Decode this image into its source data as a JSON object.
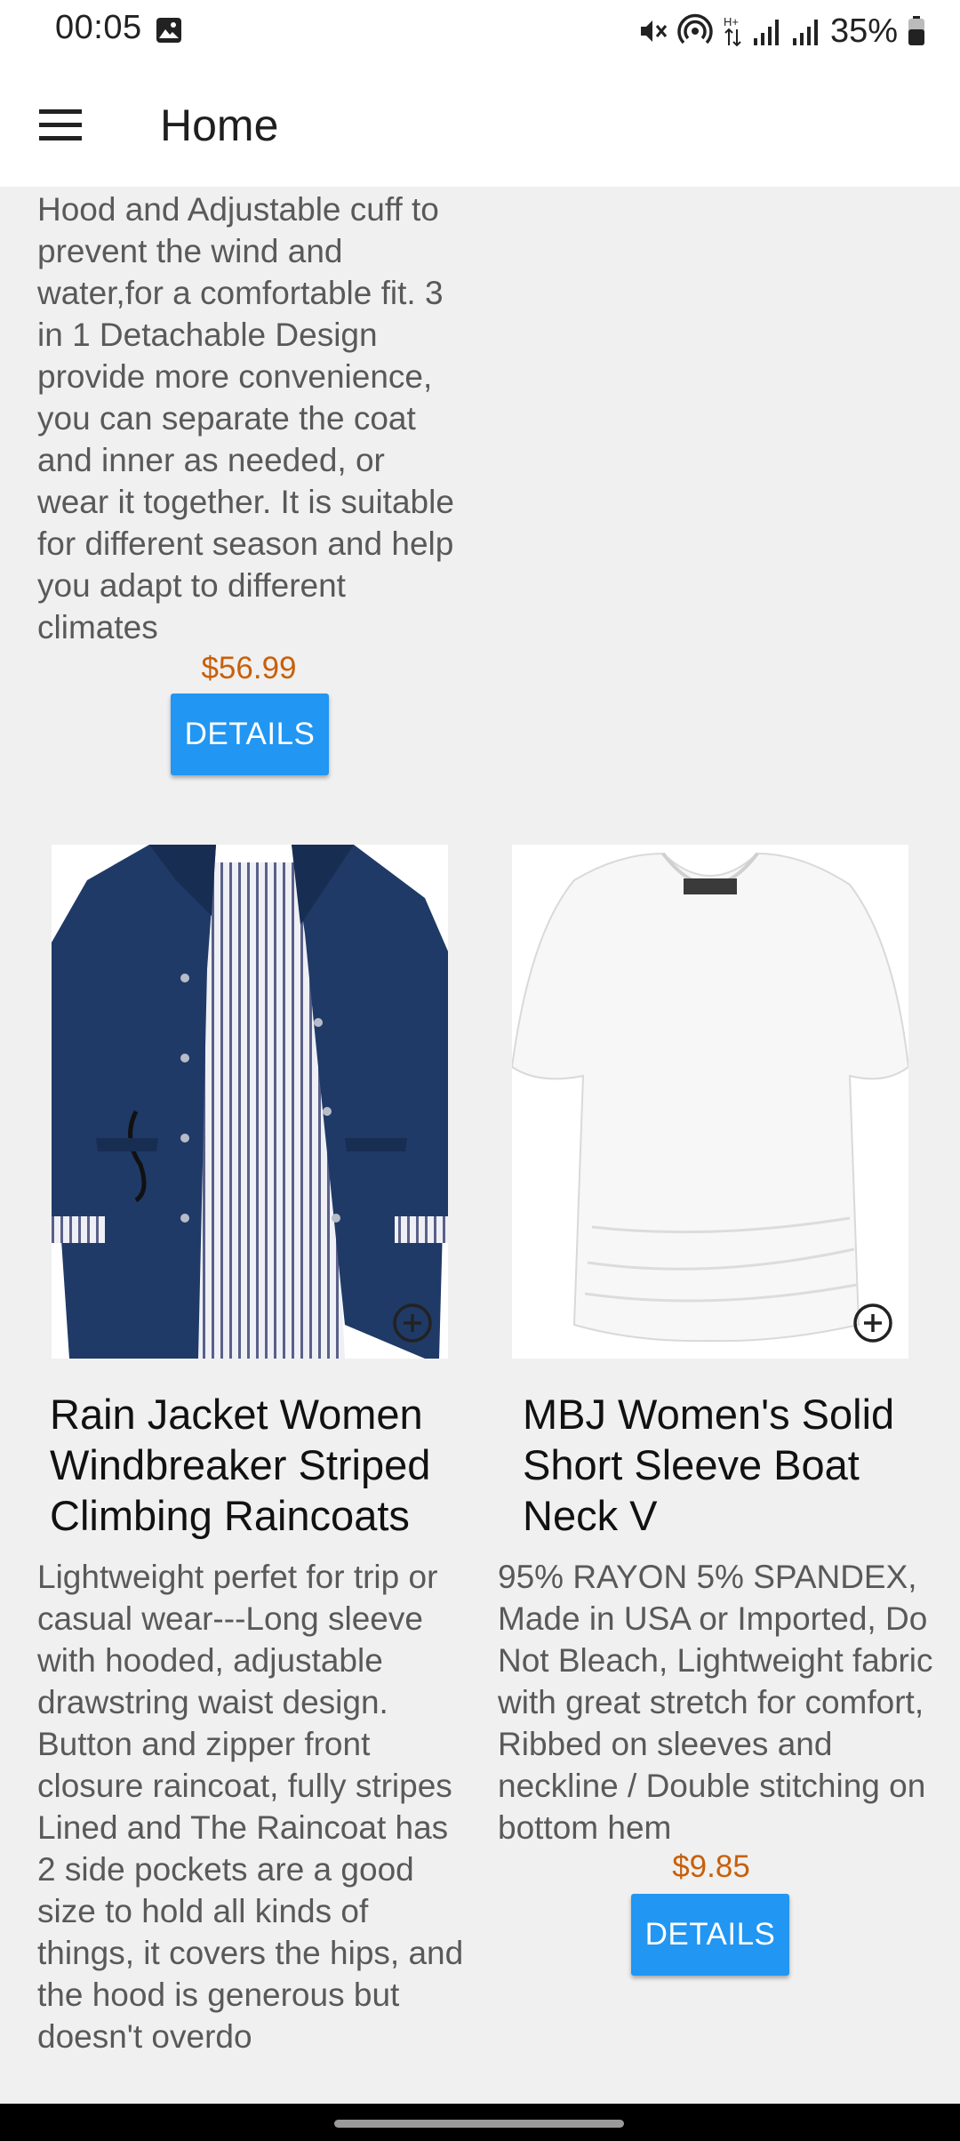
{
  "status_bar": {
    "time": "00:05",
    "battery": "35%",
    "icons": [
      "gallery-icon",
      "mute-icon",
      "hotspot-icon",
      "data-arrows-icon",
      "signal-icon",
      "signal-icon",
      "battery-icon"
    ]
  },
  "app_bar": {
    "title": "Home",
    "menu_icon": "hamburger-menu-icon"
  },
  "products": [
    {
      "title": "",
      "description": "Hood and Adjustable cuff to prevent the wind and water,for a comfortable fit. 3 in 1 Detachable Design provide more convenience, you can separate the coat and inner as needed, or wear it together. It is suitable for different season and help you adapt to different climates",
      "price": "$56.99",
      "button_label": "DETAILS"
    },
    {
      "title": "Rain Jacket Women Windbreaker Striped Climbing Raincoats",
      "description": "Lightweight perfet for trip or casual wear---Long sleeve with hooded, adjustable drawstring waist design. Button and zipper front closure raincoat, fully stripes Lined and The Raincoat has 2 side pockets are a good size to hold all kinds of things, it covers the hips, and the hood is generous but doesn't overdo",
      "image": "navy-striped-raincoat",
      "price": "",
      "button_label": "DETAILS"
    },
    {
      "title": "MBJ Women's Solid Short Sleeve Boat Neck V",
      "description": "95% RAYON 5% SPANDEX, Made in USA or Imported, Do Not Bleach, Lightweight fabric with great stretch for comfort, Ribbed on sleeves and neckline / Double stitching on bottom hem",
      "image": "white-boat-neck-tshirt",
      "price": "$9.85",
      "button_label": "DETAILS"
    }
  ],
  "colors": {
    "accent": "#2196f3",
    "price": "#c8600a",
    "background": "#f0f0f0"
  }
}
